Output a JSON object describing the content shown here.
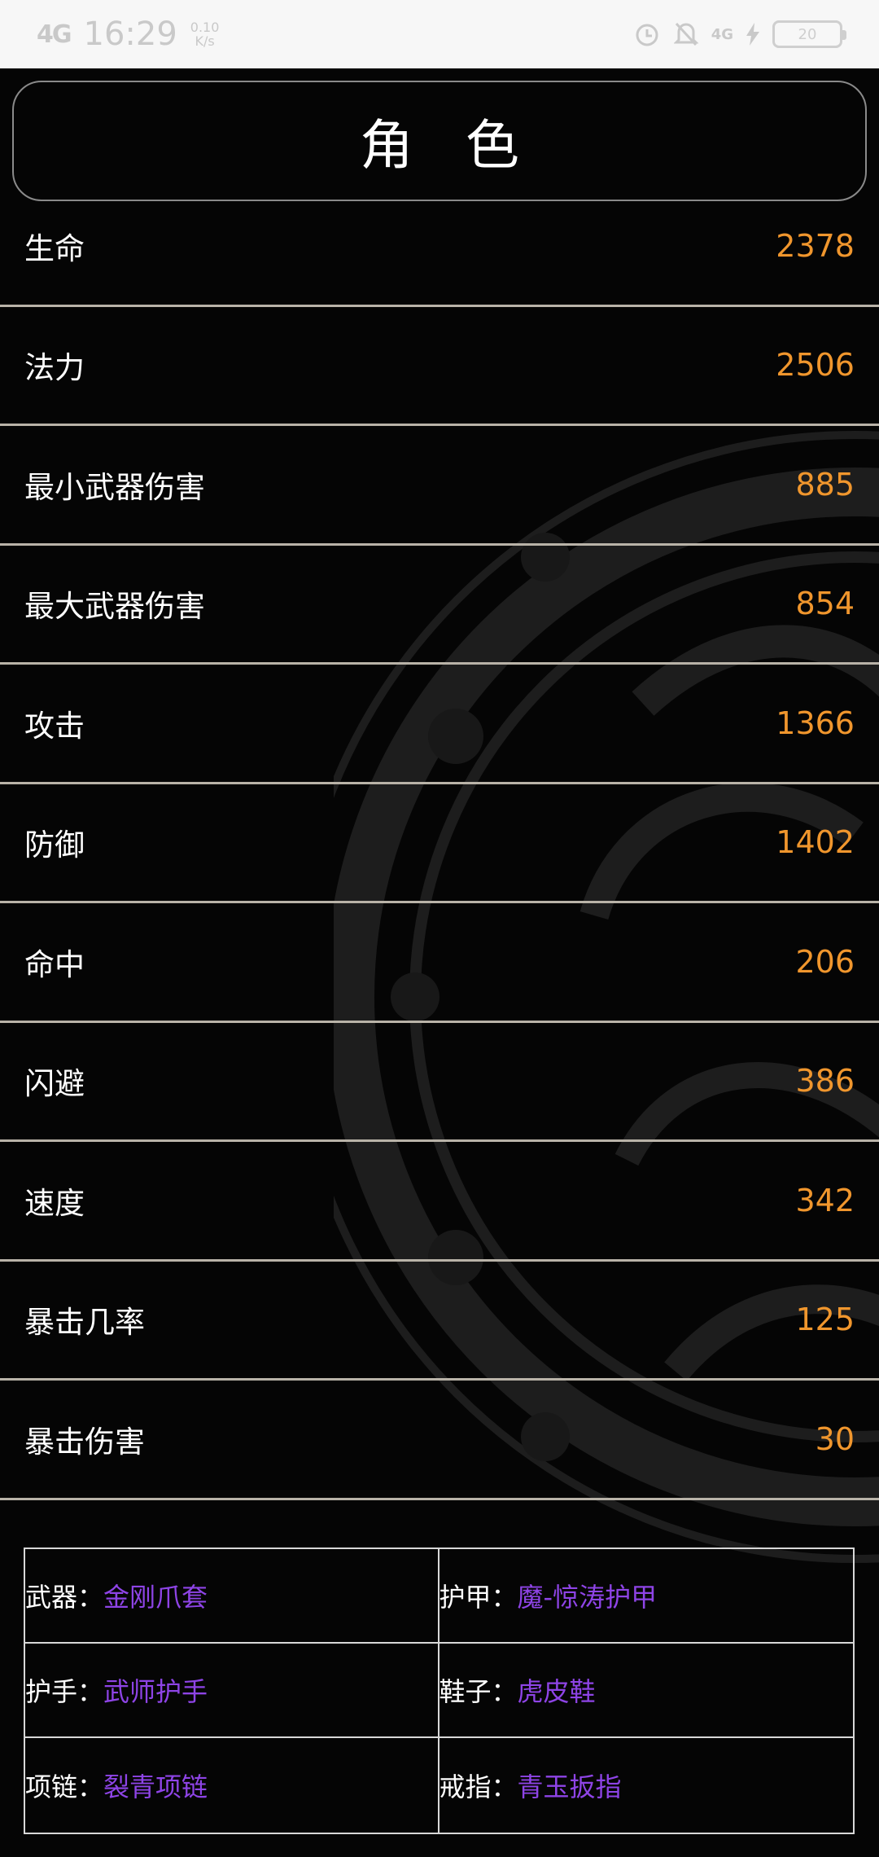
{
  "status_bar": {
    "signal": "4G",
    "time": "16:29",
    "speed_value": "0.10",
    "speed_unit": "K/s",
    "network": "4G",
    "battery": "20"
  },
  "header": {
    "title": "角色"
  },
  "stats": [
    {
      "name": "生命",
      "value": "2378"
    },
    {
      "name": "法力",
      "value": "2506"
    },
    {
      "name": "最小武器伤害",
      "value": "885"
    },
    {
      "name": "最大武器伤害",
      "value": "854"
    },
    {
      "name": "攻击",
      "value": "1366"
    },
    {
      "name": "防御",
      "value": "1402"
    },
    {
      "name": "命中",
      "value": "206"
    },
    {
      "name": "闪避",
      "value": "386"
    },
    {
      "name": "速度",
      "value": "342"
    },
    {
      "name": "暴击几率",
      "value": "125"
    },
    {
      "name": "暴击伤害",
      "value": "30"
    }
  ],
  "equipment": [
    {
      "label": "武器：",
      "item": "金刚爪套"
    },
    {
      "label": "护甲：",
      "item": "魔-惊涛护甲"
    },
    {
      "label": "护手：",
      "item": "武师护手"
    },
    {
      "label": "鞋子：",
      "item": "虎皮鞋"
    },
    {
      "label": "项链：",
      "item": "裂青项链"
    },
    {
      "label": "戒指：",
      "item": "青玉扳指"
    }
  ],
  "colors": {
    "stat_value": "#f0962d",
    "equip_item": "#8e44e6",
    "divider": "#b9b3a8"
  }
}
